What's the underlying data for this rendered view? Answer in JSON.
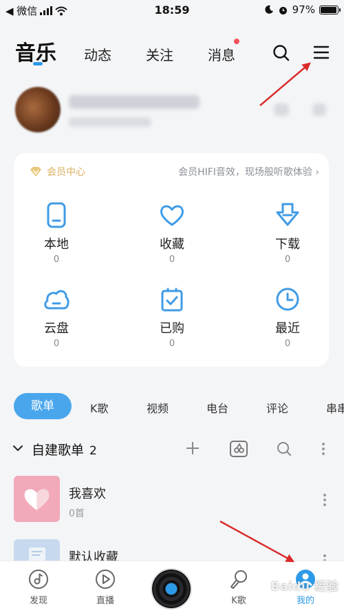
{
  "status_bar": {
    "back_label": "◀ 微信",
    "time": "18:59",
    "battery": "97%",
    "battery_fraction": 0.97
  },
  "top_nav": {
    "tabs": [
      "音乐",
      "动态",
      "关注",
      "消息"
    ],
    "active_tab": "音乐",
    "search_icon": "search-icon",
    "menu_icon": "menu-icon",
    "unread_dot_color": "#f0525a"
  },
  "member": {
    "title": "会员中心",
    "desc": "会员HIFI音效，现场般听歌体验",
    "items": [
      {
        "label": "本地",
        "count": "0",
        "icon": "phone-icon"
      },
      {
        "label": "收藏",
        "count": "0",
        "icon": "heart-icon"
      },
      {
        "label": "下载",
        "count": "0",
        "icon": "download-icon"
      },
      {
        "label": "云盘",
        "count": "0",
        "icon": "cloud-icon"
      },
      {
        "label": "已购",
        "count": "0",
        "icon": "bag-icon"
      },
      {
        "label": "最近",
        "count": "0",
        "icon": "clock-icon"
      }
    ]
  },
  "categories": [
    "歌单",
    "K歌",
    "视频",
    "电台",
    "评论",
    "串串"
  ],
  "playlist_section": {
    "title": "自建歌单",
    "count": "2"
  },
  "playlists": [
    {
      "name": "我喜欢",
      "sub": "0首"
    },
    {
      "name": "默认收藏",
      "sub": ""
    }
  ],
  "bottom_nav": [
    {
      "label": "发现",
      "icon": "discover-icon"
    },
    {
      "label": "直播",
      "icon": "play-icon"
    },
    {
      "label": "",
      "icon": "vinyl-icon"
    },
    {
      "label": "K歌",
      "icon": "k-song-icon"
    },
    {
      "label": "我的",
      "icon": "profile-icon"
    }
  ],
  "accent_color": "#2d9ae8",
  "vip_color": "#d8b15d",
  "watermark": "Baidu 经验"
}
